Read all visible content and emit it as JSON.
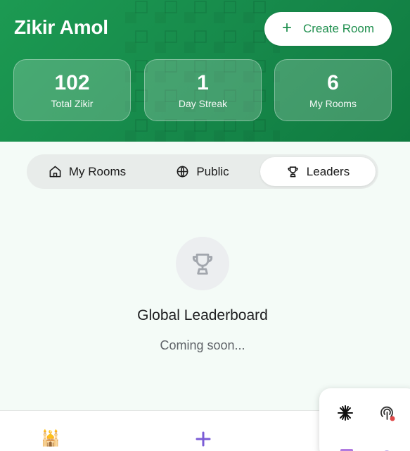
{
  "header": {
    "title": "Zikir Amol",
    "create_button_label": "Create Room",
    "stats": [
      {
        "value": "102",
        "label": "Total Zikir"
      },
      {
        "value": "1",
        "label": "Day Streak"
      },
      {
        "value": "6",
        "label": "My Rooms"
      }
    ]
  },
  "tabs": [
    {
      "label": "My Rooms",
      "icon": "home-icon",
      "active": false
    },
    {
      "label": "Public",
      "icon": "globe-icon",
      "active": false
    },
    {
      "label": "Leaders",
      "icon": "trophy-icon",
      "active": true
    }
  ],
  "empty_state": {
    "icon": "trophy-icon",
    "title": "Global Leaderboard",
    "subtitle": "Coming soon..."
  },
  "bottom_nav": {
    "items": [
      {
        "icon": "mosque-icon",
        "glyph": "🕌"
      },
      {
        "icon": "plus-icon"
      }
    ]
  },
  "floating_panel": {
    "icons": [
      "sparkle-icon",
      "recording-icon"
    ]
  },
  "colors": {
    "brand_green": "#1c9a52",
    "accent_purple": "#7b5cd6",
    "record_red": "#e04848"
  }
}
